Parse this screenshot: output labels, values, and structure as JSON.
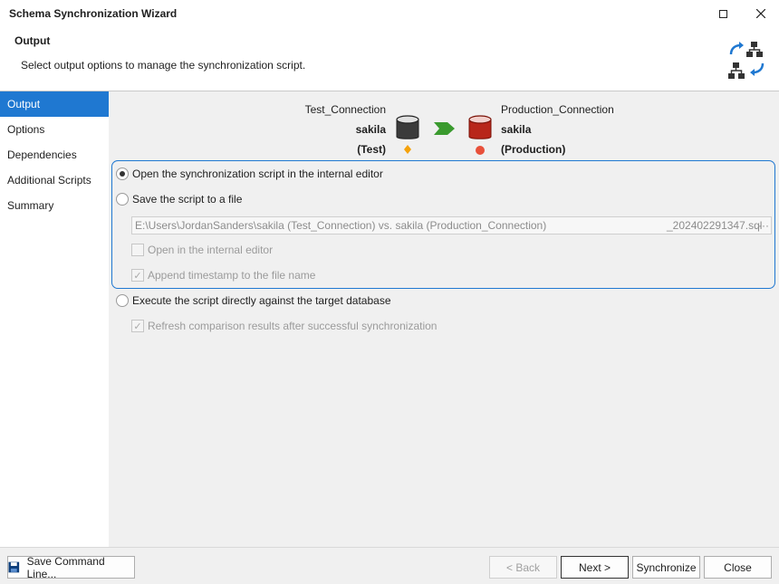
{
  "window": {
    "title": "Schema Synchronization Wizard"
  },
  "header": {
    "title": "Output",
    "description": "Select output options to manage the synchronization script.",
    "icon": "schema-sync-icon"
  },
  "sidebar": {
    "items": [
      {
        "label": "Output",
        "active": true
      },
      {
        "label": "Options",
        "active": false
      },
      {
        "label": "Dependencies",
        "active": false
      },
      {
        "label": "Additional Scripts",
        "active": false
      },
      {
        "label": "Summary",
        "active": false
      }
    ]
  },
  "source": {
    "connection": "Test_Connection",
    "database": "sakila",
    "environment": "(Test)",
    "color": "#f5a20b"
  },
  "target": {
    "connection": "Production_Connection",
    "database": "sakila",
    "environment": "(Production)",
    "color": "#e8503a"
  },
  "options": {
    "open_internal_editor": {
      "label": "Open the synchronization script in the internal editor",
      "selected": true
    },
    "save_to_file": {
      "label": "Save the script to a file",
      "selected": false
    },
    "file_path_left": "E:\\Users\\JordanSanders\\sakila (Test_Connection) vs. sakila (Production_Connection)",
    "file_path_right": "_202402291347.sql",
    "file_more": "···",
    "open_in_editor": {
      "label": "Open in the internal editor",
      "checked": false
    },
    "append_timestamp": {
      "label": "Append timestamp to the file name",
      "checked": true
    },
    "execute_directly": {
      "label": "Execute the script directly against the target database",
      "selected": false
    },
    "refresh_results": {
      "label": "Refresh comparison results after successful synchronization",
      "checked": true
    }
  },
  "footer": {
    "save_command_line": "Save Command Line...",
    "back": "< Back",
    "next": "Next >",
    "synchronize": "Synchronize",
    "close": "Close"
  },
  "colors": {
    "accent": "#1f78d1",
    "arrow": "#3a9a2e",
    "source_db": "#3b3b3b",
    "target_db": "#b8261a"
  }
}
